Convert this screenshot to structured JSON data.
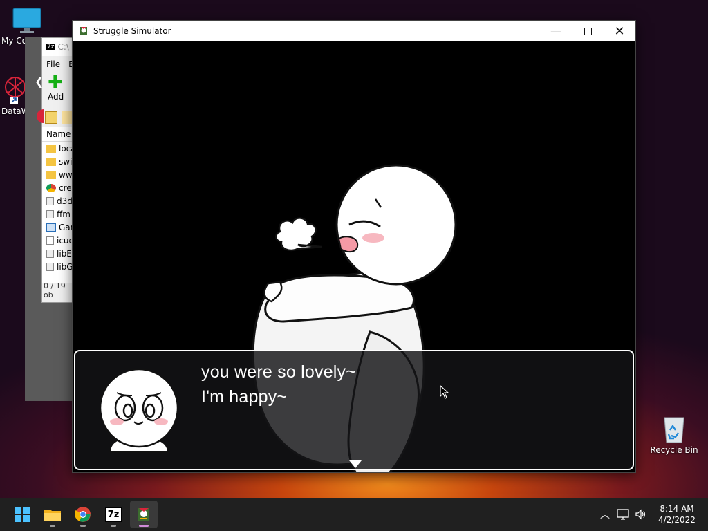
{
  "desktop": {
    "icons": [
      {
        "label": "My Co"
      },
      {
        "label": "DataW"
      },
      {
        "label": "Recycle Bin"
      }
    ]
  },
  "zip_window": {
    "title": "C:\\",
    "menu": [
      "File",
      "E"
    ],
    "add_label": "Add",
    "column_name": "Name",
    "files": [
      "loca",
      "swif",
      "www",
      "crec",
      "d3d",
      "ffm",
      "Gan",
      "icud",
      "libE",
      "libG"
    ],
    "status": "0 / 19 ob"
  },
  "game_window": {
    "title": "Struggle Simulator",
    "dialog": {
      "line1": "you were so lovely~",
      "line2": "I'm happy~"
    }
  },
  "taskbar": {
    "apps": [
      "start-icon",
      "file-explorer-icon",
      "chrome-icon",
      "7zip-icon",
      "struggle-simulator-icon"
    ],
    "clock": {
      "time": "8:14 AM",
      "date": "4/2/2022"
    }
  },
  "colors": {
    "taskbar": "#202020",
    "active_indicator": "#cf8bd9",
    "dialog_border": "#ffffff"
  }
}
